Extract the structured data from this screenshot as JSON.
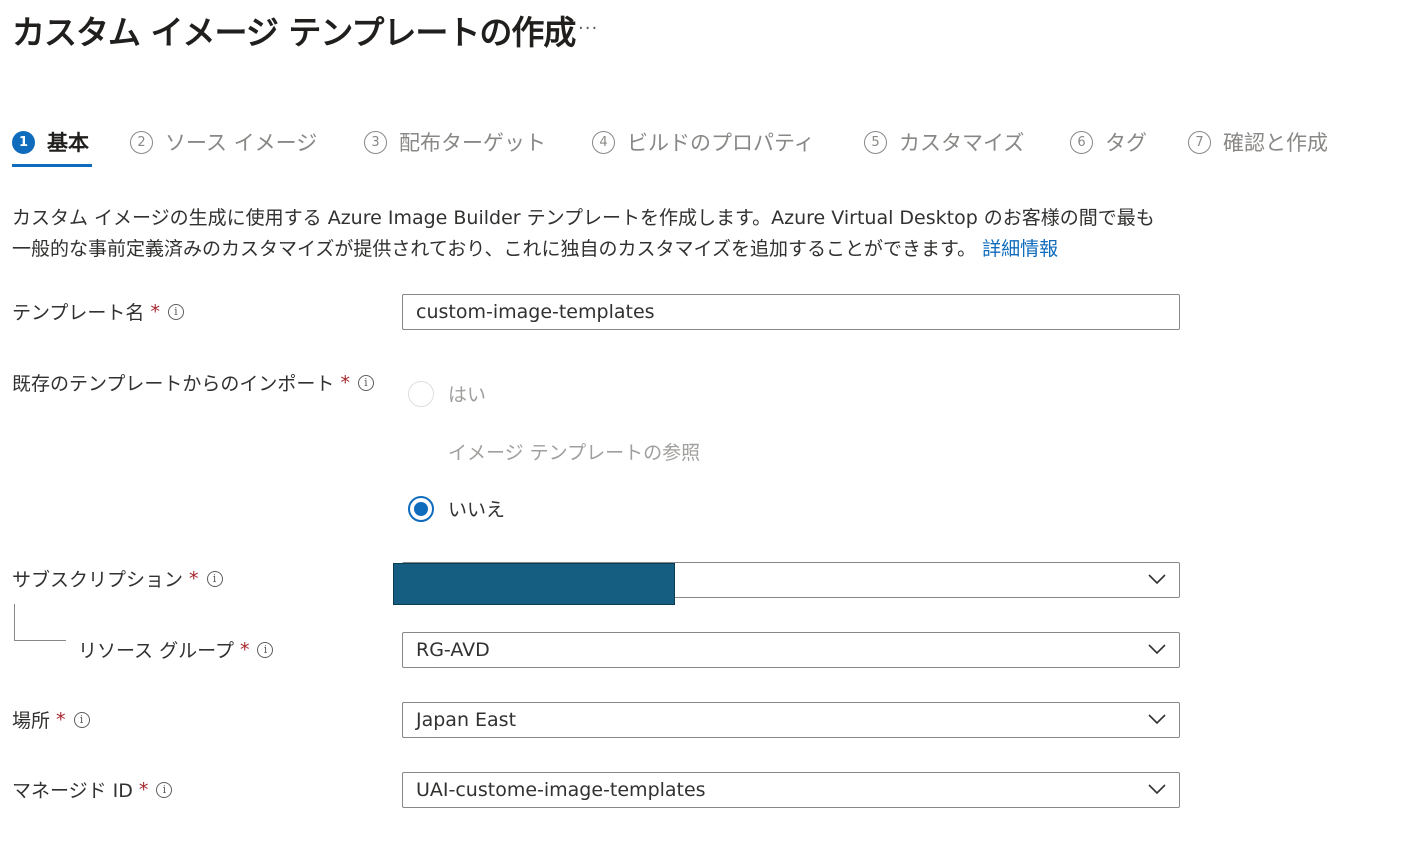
{
  "page": {
    "title": "カスタム イメージ テンプレートの作成",
    "more": "···"
  },
  "steps": [
    {
      "num": "1",
      "label": "基本",
      "active": true
    },
    {
      "num": "2",
      "label": "ソース イメージ"
    },
    {
      "num": "3",
      "label": "配布ターゲット"
    },
    {
      "num": "4",
      "label": "ビルドのプロパティ"
    },
    {
      "num": "5",
      "label": "カスタマイズ"
    },
    {
      "num": "6",
      "label": "タグ"
    },
    {
      "num": "7",
      "label": "確認と作成"
    }
  ],
  "description": {
    "line1": "カスタム イメージの生成に使用する Azure Image Builder テンプレートを作成します。Azure Virtual Desktop のお客様の間で最も",
    "line2": "一般的な事前定義済みのカスタマイズが提供されており、これに独自のカスタマイズを追加することができます。",
    "link": "詳細情報"
  },
  "form": {
    "required_mark": "*",
    "info_glyph": "i",
    "template_name": {
      "label": "テンプレート名",
      "value": "custom-image-templates"
    },
    "import": {
      "label": "既存のテンプレートからのインポート",
      "yes": "はい",
      "browse": "イメージ テンプレートの参照",
      "no": "いいえ"
    },
    "subscription": {
      "label": "サブスクリプション",
      "value": ""
    },
    "resource_group": {
      "label": "リソース グループ",
      "value": "RG-AVD"
    },
    "location": {
      "label": "場所",
      "value": "Japan East"
    },
    "managed_id": {
      "label": "マネージド ID",
      "value": "UAI-custome-image-templates"
    }
  },
  "colors": {
    "accent": "#0f6cbd",
    "redaction": "#155e82"
  }
}
